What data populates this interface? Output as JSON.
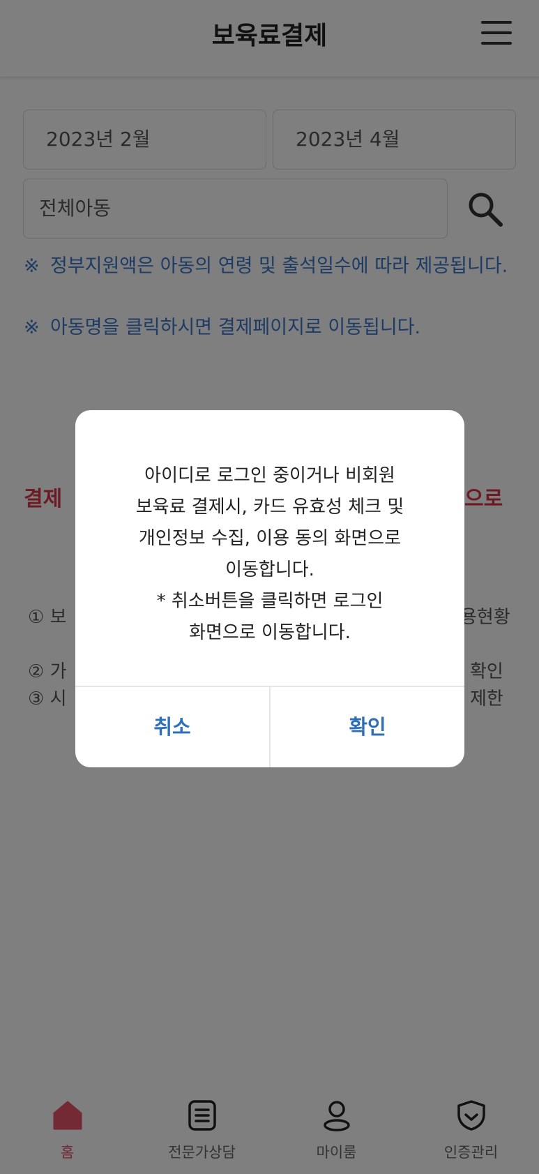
{
  "header": {
    "title": "보육료결제",
    "menu_icon": "hamburger-menu-icon"
  },
  "filters": {
    "start_month": "2023년 2월",
    "end_month": "2023년 4월",
    "child_select": "전체아동",
    "search_icon": "search-icon"
  },
  "notices": [
    {
      "mark": "※",
      "text": "정부지원액은 아동의 연령 및 출석일수에 따라 제공됩니다."
    },
    {
      "mark": "※",
      "text": "아동명을 클릭하시면 결제페이지로 이동됩니다."
    }
  ],
  "background": {
    "red_left": "결제",
    "red_right": "으로",
    "line1_left": "① 보",
    "line1_right": "용현황",
    "line2_left": "② 가",
    "line2_right": "확인",
    "line3_left": "③ 시",
    "line3_right": "제한"
  },
  "dialog": {
    "message": "아이디로 로그인 중이거나 비회원\n보육료 결제시, 카드 유효성 체크 및\n개인정보 수집, 이용 동의 화면으로\n이동합니다.\n* 취소버튼을 클릭하면 로그인\n화면으로 이동합니다.",
    "cancel_label": "취소",
    "confirm_label": "확인"
  },
  "tabs": [
    {
      "label": "홈",
      "icon": "home-icon",
      "active": true
    },
    {
      "label": "전문가상담",
      "icon": "document-icon",
      "active": false
    },
    {
      "label": "마이룸",
      "icon": "user-icon",
      "active": false
    },
    {
      "label": "인증관리",
      "icon": "shield-icon",
      "active": false
    }
  ],
  "colors": {
    "accent_blue": "#2f6fb8",
    "notice_blue": "#3d76c8",
    "alert_red": "#d9364a",
    "active_tab": "#e8546a"
  }
}
